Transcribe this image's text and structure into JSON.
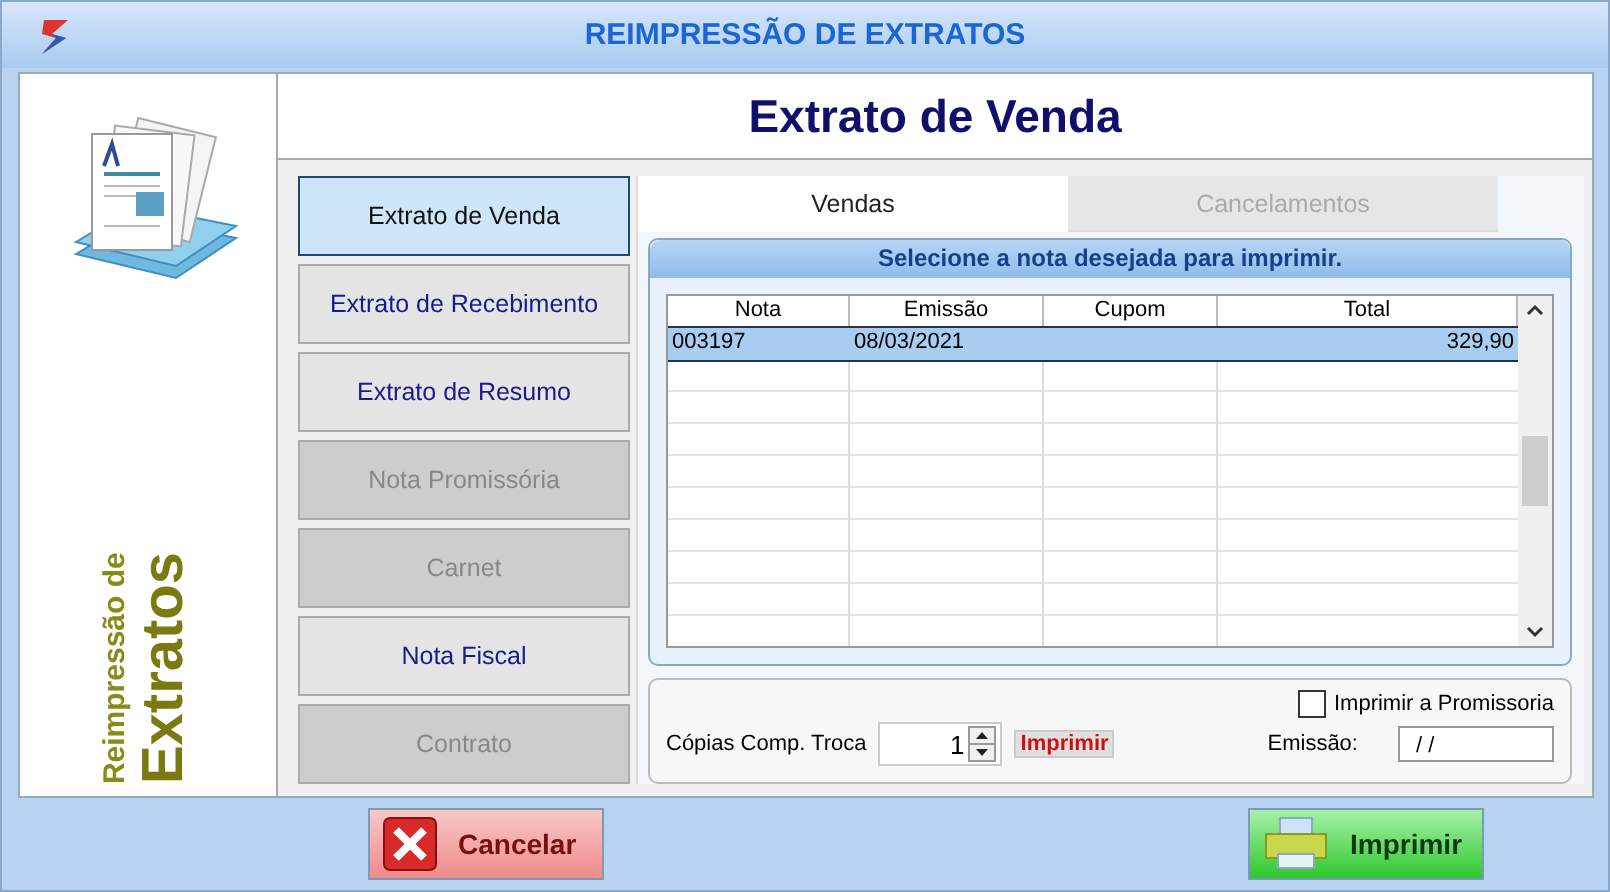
{
  "window": {
    "title": "REIMPRESSÃO DE EXTRATOS"
  },
  "sidebar": {
    "caption_small": "Reimpressão de",
    "caption_large": "Extratos"
  },
  "header": {
    "title": "Extrato de Venda"
  },
  "menu_buttons": [
    {
      "label": "Extrato de Venda",
      "selected": true,
      "disabled": false
    },
    {
      "label": "Extrato de Recebimento",
      "selected": false,
      "disabled": false
    },
    {
      "label": "Extrato de Resumo",
      "selected": false,
      "disabled": false
    },
    {
      "label": "Nota Promissória",
      "selected": false,
      "disabled": true
    },
    {
      "label": "Carnet",
      "selected": false,
      "disabled": true
    },
    {
      "label": "Nota Fiscal",
      "selected": false,
      "disabled": false
    },
    {
      "label": "Contrato",
      "selected": false,
      "disabled": true
    }
  ],
  "tabs": [
    {
      "label": "Vendas",
      "selected": true
    },
    {
      "label": "Cancelamentos",
      "selected": false
    }
  ],
  "grid": {
    "title": "Selecione a nota desejada para imprimir.",
    "columns": [
      "Nota",
      "Emissão",
      "Cupom",
      "Total"
    ],
    "rows": [
      {
        "cells": [
          "003197",
          "08/03/2021",
          "",
          "329,90"
        ],
        "selected": true
      }
    ]
  },
  "options": {
    "promissoria": {
      "label": "Imprimir a Promissoria",
      "checked": false
    },
    "copies_label": "Cópias Comp. Troca",
    "copies_value": "1",
    "copies_print": "Imprimir",
    "emissao_label": "Emissão:",
    "emissao_value": " / /"
  },
  "buttons": [
    {
      "kind": "cancel",
      "label": "Cancelar"
    },
    {
      "kind": "print",
      "label": "Imprimir"
    }
  ]
}
